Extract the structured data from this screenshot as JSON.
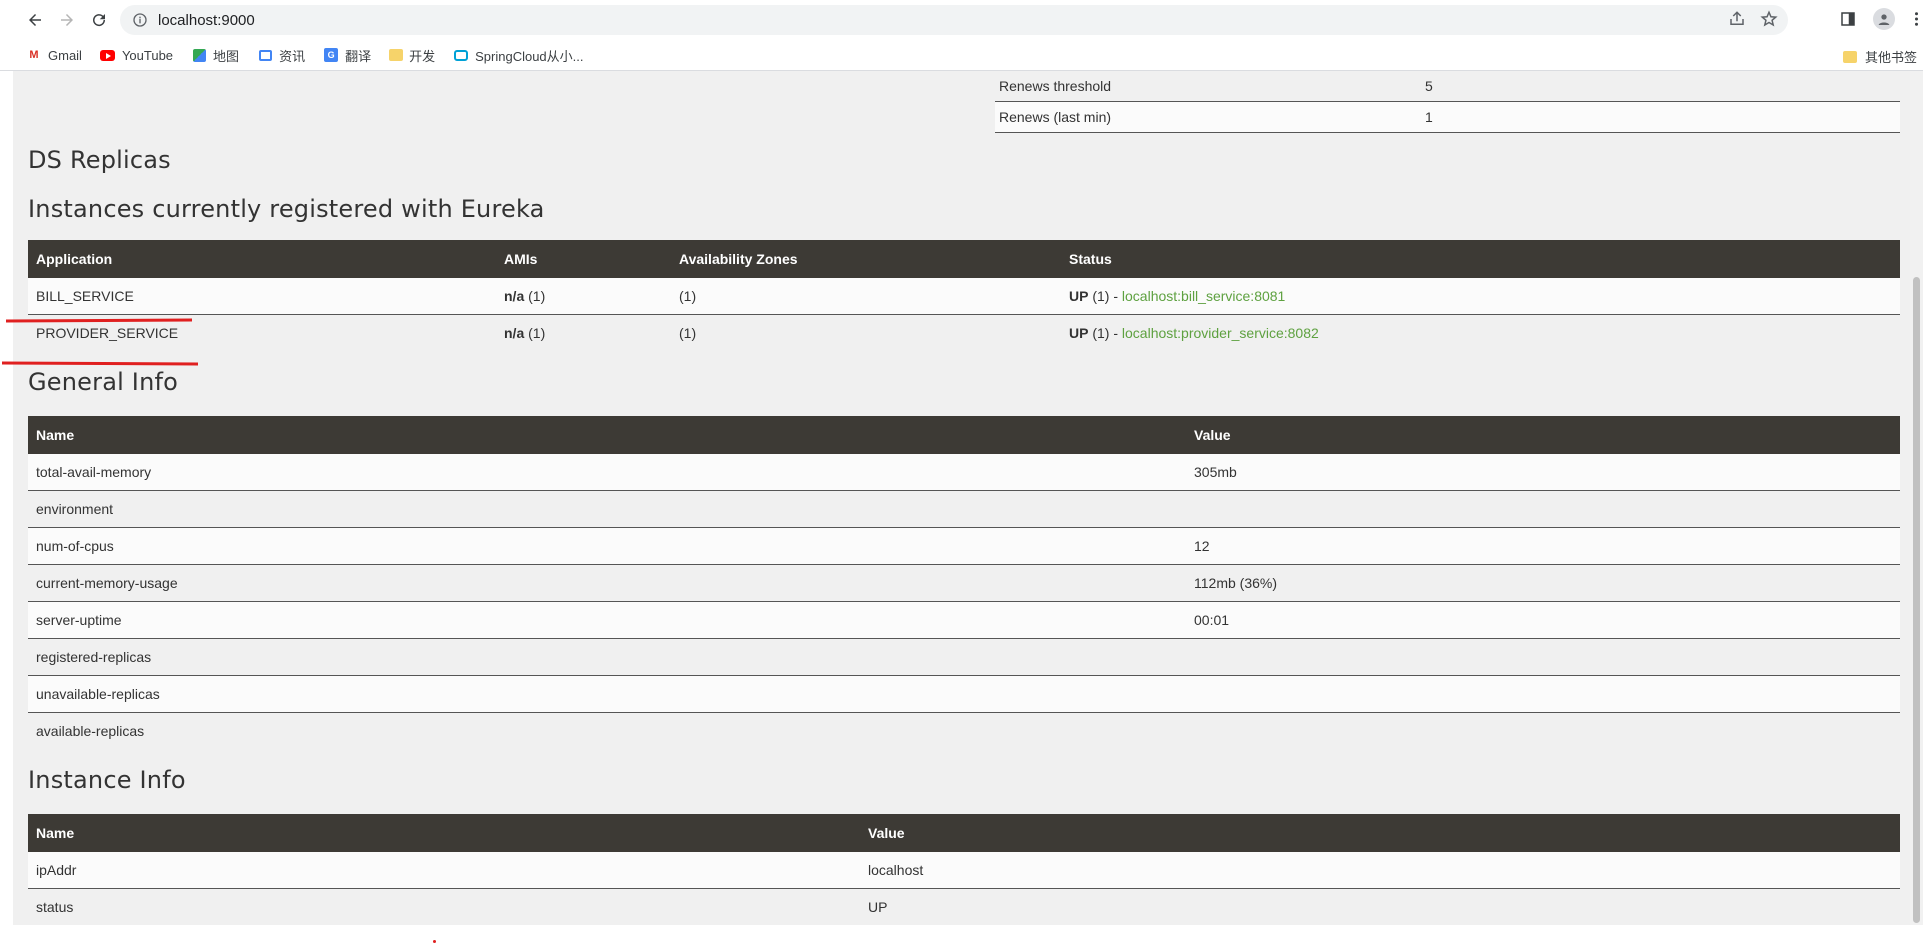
{
  "browser": {
    "url": "localhost:9000",
    "bookmarks": [
      {
        "label": "Gmail",
        "icon": "gmail-icon"
      },
      {
        "label": "YouTube",
        "icon": "youtube-icon"
      },
      {
        "label": "地图",
        "icon": "maps-icon"
      },
      {
        "label": "资讯",
        "icon": "news-icon"
      },
      {
        "label": "翻译",
        "icon": "translate-icon"
      },
      {
        "label": "开发",
        "icon": "folder-icon"
      },
      {
        "label": "SpringCloud从小...",
        "icon": "bilibili-icon"
      }
    ],
    "other_bookmarks": "其他书签"
  },
  "renews": [
    {
      "name": "Renews threshold",
      "value": "5"
    },
    {
      "name": "Renews (last min)",
      "value": "1"
    }
  ],
  "ds_replicas": {
    "title": "DS Replicas"
  },
  "instances": {
    "title": "Instances currently registered with Eureka",
    "headers": [
      "Application",
      "AMIs",
      "Availability Zones",
      "Status"
    ],
    "rows": [
      {
        "application": "BILL_SERVICE",
        "amis_bold": "n/a",
        "amis_count": "(1)",
        "zones": "(1)",
        "status_bold": "UP",
        "status_count": "(1) -",
        "link": "localhost:bill_service:8081"
      },
      {
        "application": "PROVIDER_SERVICE",
        "amis_bold": "n/a",
        "amis_count": "(1)",
        "zones": "(1)",
        "status_bold": "UP",
        "status_count": "(1) -",
        "link": "localhost:provider_service:8082"
      }
    ]
  },
  "general_info": {
    "title": "General Info",
    "headers": [
      "Name",
      "Value"
    ],
    "rows": [
      {
        "name": "total-avail-memory",
        "value": "305mb"
      },
      {
        "name": "environment",
        "value": ""
      },
      {
        "name": "num-of-cpus",
        "value": "12"
      },
      {
        "name": "current-memory-usage",
        "value": "112mb (36%)"
      },
      {
        "name": "server-uptime",
        "value": "00:01"
      },
      {
        "name": "registered-replicas",
        "value": ""
      },
      {
        "name": "unavailable-replicas",
        "value": ""
      },
      {
        "name": "available-replicas",
        "value": ""
      }
    ]
  },
  "instance_info": {
    "title": "Instance Info",
    "headers": [
      "Name",
      "Value"
    ],
    "rows": [
      {
        "name": "ipAddr",
        "value": "localhost"
      },
      {
        "name": "status",
        "value": "UP"
      }
    ]
  },
  "colors": {
    "header_bg": "#3d3a35",
    "link": "#5ea140",
    "annotation": "#e02020"
  }
}
